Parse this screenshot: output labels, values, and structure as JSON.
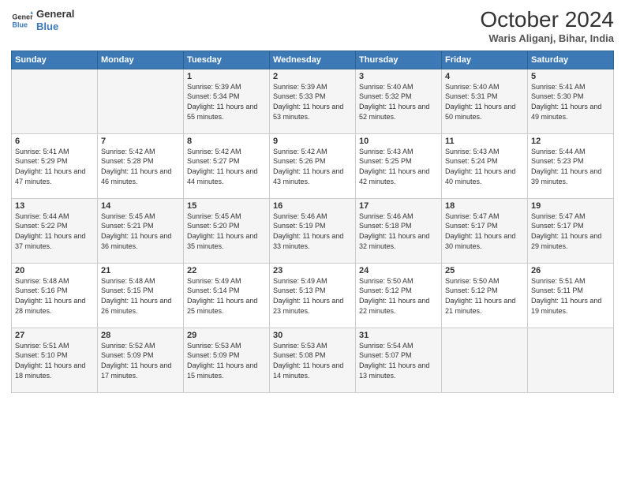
{
  "header": {
    "logo_line1": "General",
    "logo_line2": "Blue",
    "month": "October 2024",
    "location": "Waris Aliganj, Bihar, India"
  },
  "weekdays": [
    "Sunday",
    "Monday",
    "Tuesday",
    "Wednesday",
    "Thursday",
    "Friday",
    "Saturday"
  ],
  "weeks": [
    [
      {
        "day": "",
        "content": ""
      },
      {
        "day": "",
        "content": ""
      },
      {
        "day": "1",
        "content": "Sunrise: 5:39 AM\nSunset: 5:34 PM\nDaylight: 11 hours and 55 minutes."
      },
      {
        "day": "2",
        "content": "Sunrise: 5:39 AM\nSunset: 5:33 PM\nDaylight: 11 hours and 53 minutes."
      },
      {
        "day": "3",
        "content": "Sunrise: 5:40 AM\nSunset: 5:32 PM\nDaylight: 11 hours and 52 minutes."
      },
      {
        "day": "4",
        "content": "Sunrise: 5:40 AM\nSunset: 5:31 PM\nDaylight: 11 hours and 50 minutes."
      },
      {
        "day": "5",
        "content": "Sunrise: 5:41 AM\nSunset: 5:30 PM\nDaylight: 11 hours and 49 minutes."
      }
    ],
    [
      {
        "day": "6",
        "content": "Sunrise: 5:41 AM\nSunset: 5:29 PM\nDaylight: 11 hours and 47 minutes."
      },
      {
        "day": "7",
        "content": "Sunrise: 5:42 AM\nSunset: 5:28 PM\nDaylight: 11 hours and 46 minutes."
      },
      {
        "day": "8",
        "content": "Sunrise: 5:42 AM\nSunset: 5:27 PM\nDaylight: 11 hours and 44 minutes."
      },
      {
        "day": "9",
        "content": "Sunrise: 5:42 AM\nSunset: 5:26 PM\nDaylight: 11 hours and 43 minutes."
      },
      {
        "day": "10",
        "content": "Sunrise: 5:43 AM\nSunset: 5:25 PM\nDaylight: 11 hours and 42 minutes."
      },
      {
        "day": "11",
        "content": "Sunrise: 5:43 AM\nSunset: 5:24 PM\nDaylight: 11 hours and 40 minutes."
      },
      {
        "day": "12",
        "content": "Sunrise: 5:44 AM\nSunset: 5:23 PM\nDaylight: 11 hours and 39 minutes."
      }
    ],
    [
      {
        "day": "13",
        "content": "Sunrise: 5:44 AM\nSunset: 5:22 PM\nDaylight: 11 hours and 37 minutes."
      },
      {
        "day": "14",
        "content": "Sunrise: 5:45 AM\nSunset: 5:21 PM\nDaylight: 11 hours and 36 minutes."
      },
      {
        "day": "15",
        "content": "Sunrise: 5:45 AM\nSunset: 5:20 PM\nDaylight: 11 hours and 35 minutes."
      },
      {
        "day": "16",
        "content": "Sunrise: 5:46 AM\nSunset: 5:19 PM\nDaylight: 11 hours and 33 minutes."
      },
      {
        "day": "17",
        "content": "Sunrise: 5:46 AM\nSunset: 5:18 PM\nDaylight: 11 hours and 32 minutes."
      },
      {
        "day": "18",
        "content": "Sunrise: 5:47 AM\nSunset: 5:17 PM\nDaylight: 11 hours and 30 minutes."
      },
      {
        "day": "19",
        "content": "Sunrise: 5:47 AM\nSunset: 5:17 PM\nDaylight: 11 hours and 29 minutes."
      }
    ],
    [
      {
        "day": "20",
        "content": "Sunrise: 5:48 AM\nSunset: 5:16 PM\nDaylight: 11 hours and 28 minutes."
      },
      {
        "day": "21",
        "content": "Sunrise: 5:48 AM\nSunset: 5:15 PM\nDaylight: 11 hours and 26 minutes."
      },
      {
        "day": "22",
        "content": "Sunrise: 5:49 AM\nSunset: 5:14 PM\nDaylight: 11 hours and 25 minutes."
      },
      {
        "day": "23",
        "content": "Sunrise: 5:49 AM\nSunset: 5:13 PM\nDaylight: 11 hours and 23 minutes."
      },
      {
        "day": "24",
        "content": "Sunrise: 5:50 AM\nSunset: 5:12 PM\nDaylight: 11 hours and 22 minutes."
      },
      {
        "day": "25",
        "content": "Sunrise: 5:50 AM\nSunset: 5:12 PM\nDaylight: 11 hours and 21 minutes."
      },
      {
        "day": "26",
        "content": "Sunrise: 5:51 AM\nSunset: 5:11 PM\nDaylight: 11 hours and 19 minutes."
      }
    ],
    [
      {
        "day": "27",
        "content": "Sunrise: 5:51 AM\nSunset: 5:10 PM\nDaylight: 11 hours and 18 minutes."
      },
      {
        "day": "28",
        "content": "Sunrise: 5:52 AM\nSunset: 5:09 PM\nDaylight: 11 hours and 17 minutes."
      },
      {
        "day": "29",
        "content": "Sunrise: 5:53 AM\nSunset: 5:09 PM\nDaylight: 11 hours and 15 minutes."
      },
      {
        "day": "30",
        "content": "Sunrise: 5:53 AM\nSunset: 5:08 PM\nDaylight: 11 hours and 14 minutes."
      },
      {
        "day": "31",
        "content": "Sunrise: 5:54 AM\nSunset: 5:07 PM\nDaylight: 11 hours and 13 minutes."
      },
      {
        "day": "",
        "content": ""
      },
      {
        "day": "",
        "content": ""
      }
    ]
  ]
}
